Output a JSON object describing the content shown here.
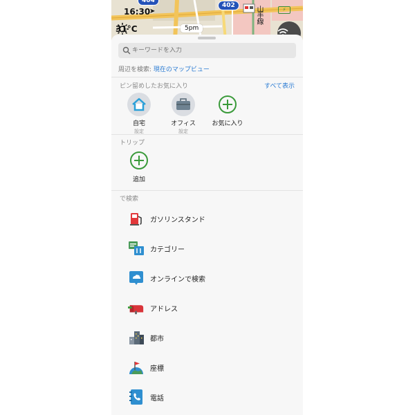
{
  "map": {
    "time": "16:30",
    "route_signs": [
      "404",
      "402"
    ],
    "street_label": "山手線",
    "temperature": "31°C",
    "clock_chip": "5pm"
  },
  "search": {
    "placeholder": "キーワードを入力"
  },
  "nearby": {
    "prefix": "周辺を検索: ",
    "link": "現在のマップビュー"
  },
  "favorites": {
    "title": "ピン留めしたお気に入り",
    "see_all": "すべて表示",
    "items": [
      {
        "name": "自宅",
        "sub": "設定",
        "icon": "home-icon"
      },
      {
        "name": "オフィス",
        "sub": "設定",
        "icon": "briefcase-icon"
      },
      {
        "name": "お気に入り",
        "sub": "",
        "icon": "add-icon"
      }
    ]
  },
  "trips": {
    "title": "トリップ",
    "add_label": "追加"
  },
  "search_by": {
    "title": "で検索",
    "items": [
      {
        "label": "ガソリンスタンド",
        "icon": "fuel-pump-icon"
      },
      {
        "label": "カテゴリー",
        "icon": "category-icon"
      },
      {
        "label": "オンラインで検索",
        "icon": "cloud-search-icon"
      },
      {
        "label": "アドレス",
        "icon": "mailbox-icon"
      },
      {
        "label": "都市",
        "icon": "city-icon"
      },
      {
        "label": "座標",
        "icon": "globe-flag-icon"
      },
      {
        "label": "電話",
        "icon": "phone-book-icon"
      }
    ]
  },
  "colors": {
    "accent_link": "#2a7bd3",
    "add_green": "#3a9a3a",
    "sheet_bg": "#f7f7f7"
  }
}
